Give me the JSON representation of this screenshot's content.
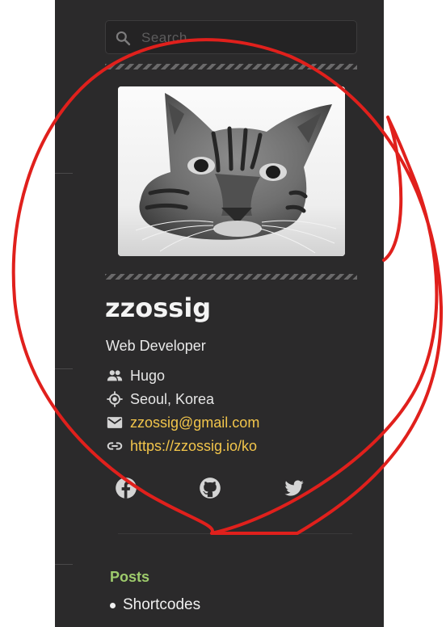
{
  "search": {
    "placeholder": "Search"
  },
  "profile": {
    "name": "zzossig",
    "role": "Web Developer",
    "details": [
      {
        "icon": "people-icon",
        "text": "Hugo"
      },
      {
        "icon": "location-icon",
        "text": "Seoul, Korea"
      },
      {
        "icon": "email-icon",
        "text": "zzossig@gmail.com"
      },
      {
        "icon": "link-icon",
        "text": "https://zzossig.io/ko"
      }
    ],
    "social": [
      "facebook-icon",
      "github-icon",
      "twitter-icon"
    ]
  },
  "posts": {
    "title": "Posts",
    "items": [
      {
        "label": "Shortcodes"
      }
    ]
  },
  "colors": {
    "sidebar_bg": "#2b2a2b",
    "link": "#f2c54b",
    "posts_heading": "#9ecb6c",
    "annotation": "#e0201c"
  }
}
